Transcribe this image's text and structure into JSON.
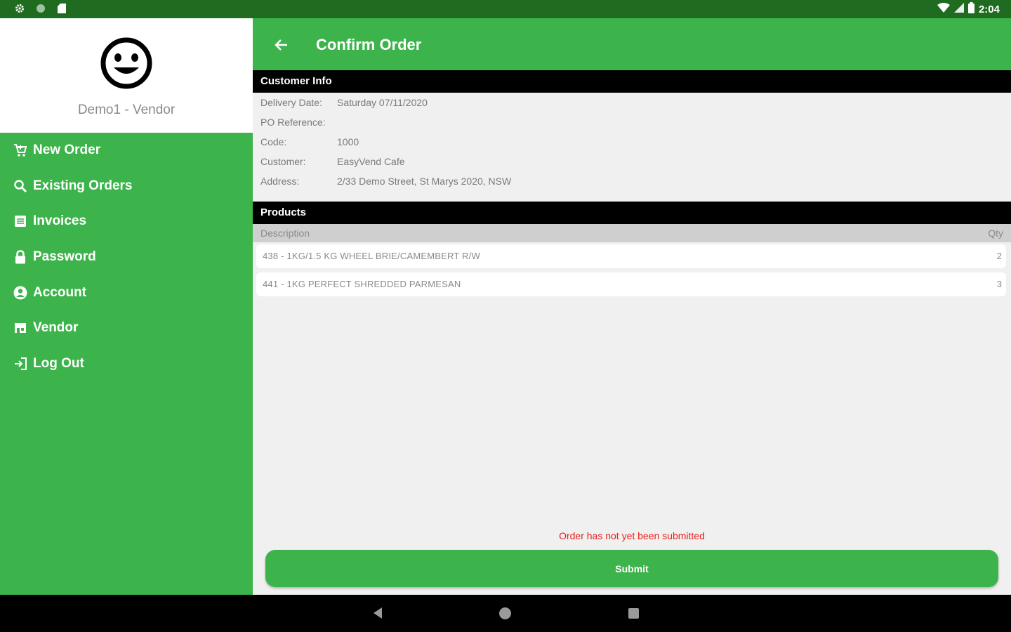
{
  "status_bar": {
    "time": "2:04",
    "icons": [
      "settings-icon",
      "circle-icon",
      "sd-card-icon",
      "wifi-icon",
      "signal-icon",
      "battery-icon"
    ]
  },
  "drawer": {
    "vendor_name": "Demo1 - Vendor",
    "items": [
      {
        "label": "New Order",
        "icon": "cart-icon"
      },
      {
        "label": "Existing Orders",
        "icon": "search-icon"
      },
      {
        "label": "Invoices",
        "icon": "invoice-icon"
      },
      {
        "label": "Password",
        "icon": "lock-icon"
      },
      {
        "label": "Account",
        "icon": "account-icon"
      },
      {
        "label": "Vendor",
        "icon": "store-icon"
      },
      {
        "label": "Log Out",
        "icon": "logout-icon"
      }
    ]
  },
  "appbar": {
    "title": "Confirm Order"
  },
  "customer_info": {
    "header": "Customer Info",
    "delivery_date_label": "Delivery Date:",
    "delivery_date_value": "Saturday 07/11/2020",
    "po_label": "PO Reference:",
    "po_value": "",
    "code_label": "Code:",
    "code_value": "1000",
    "customer_label": "Customer:",
    "customer_value": "EasyVend Cafe",
    "address_label": "Address:",
    "address_value": "2/33 Demo Street, St Marys 2020, NSW"
  },
  "products": {
    "header": "Products",
    "col_description": "Description",
    "col_qty": "Qty",
    "rows": [
      {
        "description": "438 - 1KG/1.5 KG WHEEL BRIE/CAMEMBERT R/W",
        "qty": "2"
      },
      {
        "description": "441 - 1KG PERFECT SHREDDED PARMESAN",
        "qty": "3"
      }
    ]
  },
  "footer": {
    "status_message": "Order has not yet been submitted",
    "submit_label": "Submit"
  },
  "colors": {
    "accent": "#3cb44b",
    "status_bar": "#1f6b1f",
    "error": "#e8201c"
  }
}
